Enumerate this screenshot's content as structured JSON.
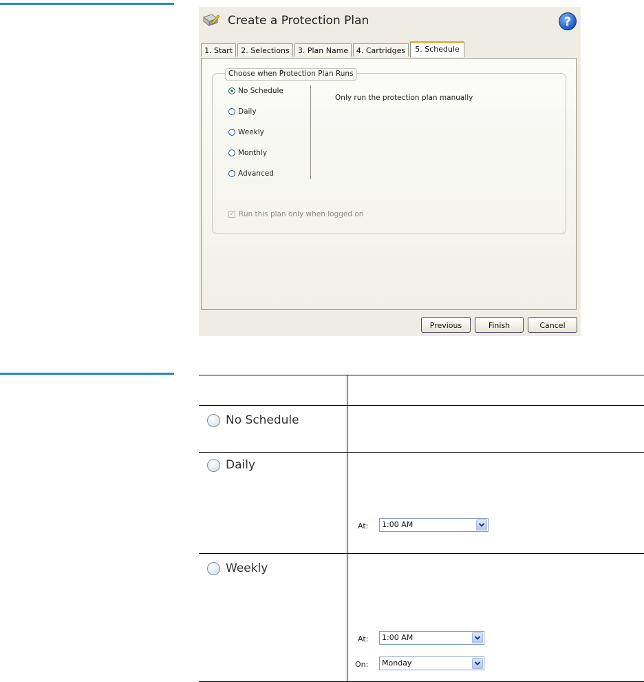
{
  "dialog": {
    "title": "Create a Protection Plan",
    "tabs": [
      {
        "label": "1. Start"
      },
      {
        "label": "2. Selections"
      },
      {
        "label": "3. Plan Name"
      },
      {
        "label": "4. Cartridges"
      },
      {
        "label": "5. Schedule",
        "active": true
      }
    ],
    "group_label": "Choose when Protection Plan Runs",
    "options": [
      {
        "label": "No Schedule",
        "selected": true
      },
      {
        "label": "Daily",
        "selected": false
      },
      {
        "label": "Weekly",
        "selected": false
      },
      {
        "label": "Monthly",
        "selected": false
      },
      {
        "label": "Advanced",
        "selected": false
      }
    ],
    "description": "Only run the protection plan manually",
    "checkbox_label": "Run this plan only when logged on",
    "checkbox_checked": true,
    "buttons": {
      "previous": "Previous",
      "finish": "Finish",
      "cancel": "Cancel"
    }
  },
  "table": {
    "rows": [
      {
        "option": "No Schedule"
      },
      {
        "option": "Daily",
        "at_label": "At:",
        "at_value": "1:00 AM"
      },
      {
        "option": "Weekly",
        "at_label": "At:",
        "at_value": "1:00 AM",
        "on_label": "On:",
        "on_value": "Monday"
      }
    ]
  },
  "colors": {
    "accent_rule": "#1e88c9",
    "tab_highlight": "#e0a41a",
    "radio_selected": "#2f9d39"
  },
  "icons": [
    "plan-edit-icon",
    "help-icon",
    "chevron-down-icon"
  ]
}
